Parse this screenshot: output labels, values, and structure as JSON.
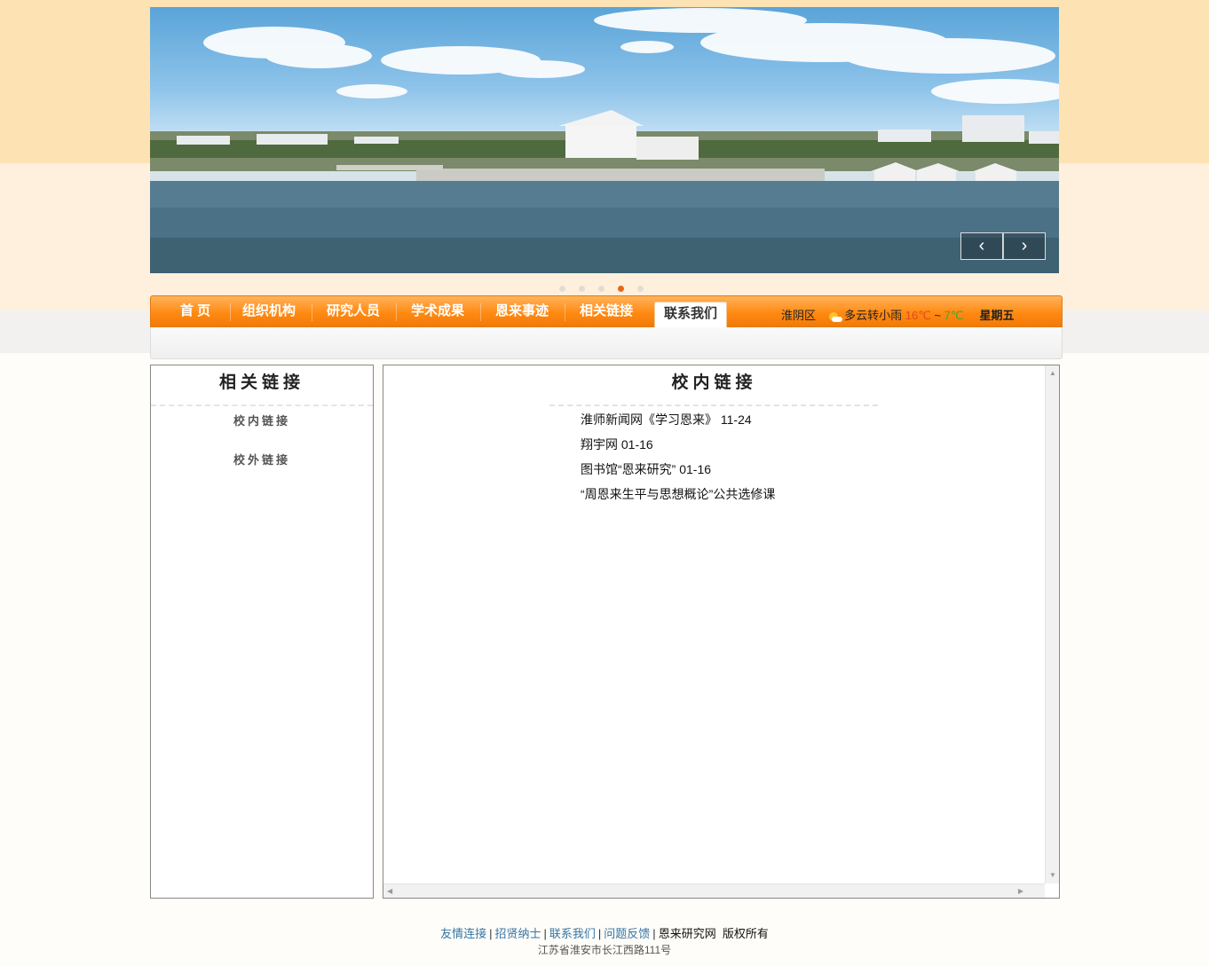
{
  "nav": {
    "items": [
      "首 页",
      "组织机构",
      "研究人员",
      "学术成果",
      "恩来事迹",
      "相关链接",
      "联系我们"
    ],
    "active_index": 6
  },
  "weather": {
    "district": "淮阴区",
    "icon": "partly-cloudy-sun-icon",
    "condition": "多云转小雨",
    "high": "16℃",
    "separator": "~",
    "low": "7℃",
    "weekday": "星期五"
  },
  "carousel": {
    "prev_icon": "chevron-left-icon",
    "next_icon": "chevron-right-icon",
    "slide_count": 5,
    "active_slide": 4
  },
  "sidebar": {
    "title": "相关链接",
    "items": [
      "校内链接",
      "校外链接"
    ]
  },
  "main": {
    "title": "校内链接",
    "links": [
      "淮师新闻网《学习恩来》 11-24",
      "翔宇网 01-16",
      "图书馆“恩来研究” 01-16",
      "“周恩来生平与思想概论”公共选修课"
    ]
  },
  "footer": {
    "links": [
      "友情连接",
      "招贤纳士",
      "联系我们",
      "问题反馈"
    ],
    "owner": "恩来研究网  版权所有",
    "address": "江苏省淮安市长江西路111号"
  },
  "colors": {
    "nav_orange": "#ff8a12",
    "active_dot": "#e8671b",
    "footer_link": "#3575a5",
    "page_top_bg": "#fde3b4"
  }
}
